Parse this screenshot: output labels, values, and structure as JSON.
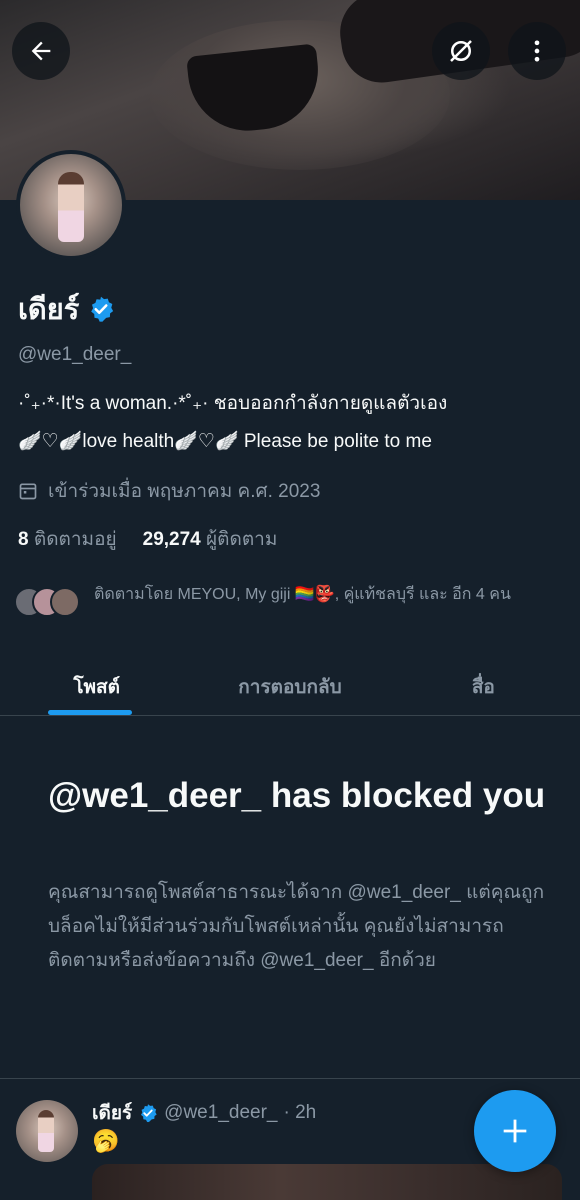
{
  "profile": {
    "display_name": "เดียร์",
    "handle": "@we1_deer_",
    "bio_line1": "·˚₊·*·It's a woman.·*˚₊· ชอบออกกำลังกายดูแลตัวเอง",
    "bio_line2": "🪽♡🪽love health🪽♡🪽 Please be polite to me",
    "joined": "เข้าร่วมเมื่อ พฤษภาคม ค.ศ. 2023",
    "following_count": "8",
    "following_label": "ติดตามอยู่",
    "followers_count": "29,274",
    "followers_label": "ผู้ติดตาม",
    "followed_by": "ติดตามโดย MEYOU, My giji 🏳️‍🌈👺, คู่แท้ชลบุรี และ อีก 4 คน"
  },
  "tabs": [
    {
      "label": "โพสต์"
    },
    {
      "label": "การตอบกลับ"
    },
    {
      "label": "สื่อ"
    }
  ],
  "blocked": {
    "title": "@we1_deer_ has blocked you",
    "description": "คุณสามารถดูโพสต์สาธารณะได้จาก @we1_deer_ แต่คุณถูกบล็อคไม่ให้มีส่วนร่วมกับโพสต์เหล่านั้น คุณยังไม่สามารถติดตามหรือส่งข้อความถึง @we1_deer_ อีกด้วย"
  },
  "tweet": {
    "name": "เดียร์",
    "handle": "@we1_deer_",
    "time": "· 2h",
    "text": "🥱"
  },
  "icons": {
    "back": "arrow-left-icon",
    "grok": "grok-icon",
    "more": "more-vertical-icon",
    "verified": "verified-badge-icon",
    "calendar": "calendar-icon",
    "compose": "plus-icon"
  },
  "colors": {
    "background": "#15202b",
    "accent": "#1d9bf0",
    "muted_text": "#8b98a5",
    "border": "#38444d"
  }
}
